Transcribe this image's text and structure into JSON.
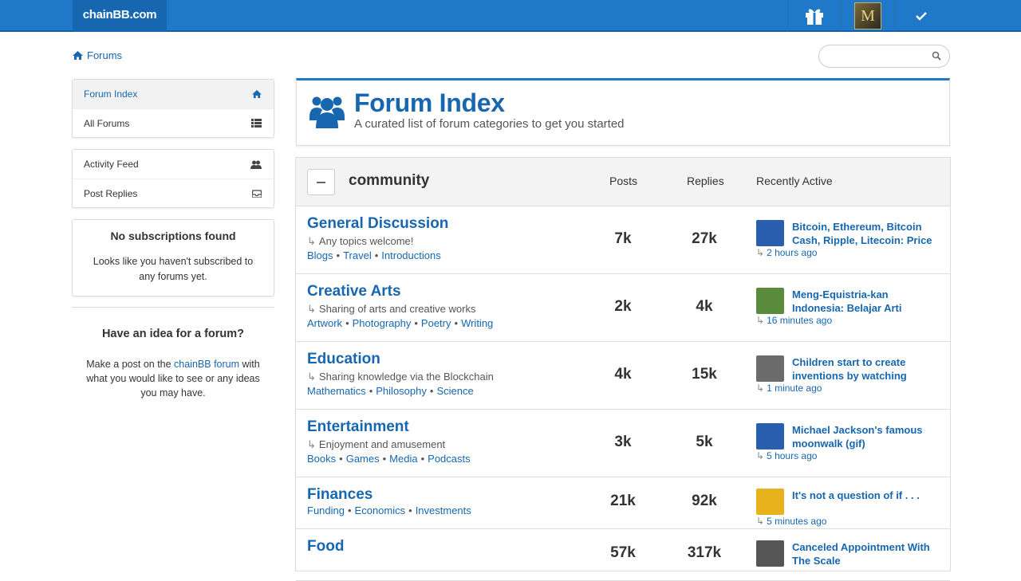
{
  "topbar": {
    "brand": "chainBB.com",
    "avatar_letter": "M"
  },
  "breadcrumb": {
    "label": "Forums"
  },
  "search": {
    "placeholder": "",
    "value": ""
  },
  "sidebar": {
    "nav": [
      {
        "label": "Forum Index",
        "icon": "home-icon"
      },
      {
        "label": "All Forums",
        "icon": "list-icon"
      }
    ],
    "activity": [
      {
        "label": "Activity Feed",
        "icon": "users-icon"
      },
      {
        "label": "Post Replies",
        "icon": "inbox-icon"
      }
    ],
    "no_subs": {
      "title": "No subscriptions found",
      "text": "Looks like you haven't subscribed to any forums yet."
    },
    "idea": {
      "title": "Have an idea for a forum?",
      "text_before": "Make a post on the ",
      "link": "chainBB forum",
      "text_after": " with what you would like to see or any ideas you may have."
    }
  },
  "header": {
    "title": "Forum Index",
    "subtitle": "A curated list of forum categories to get you started"
  },
  "category": {
    "name": "community",
    "columns": {
      "posts": "Posts",
      "replies": "Replies",
      "recent": "Recently Active"
    },
    "forums": [
      {
        "title": "General Discussion",
        "desc": "Any topics welcome!",
        "subs": [
          "Blogs",
          "Travel",
          "Introductions"
        ],
        "posts": "7k",
        "replies": "27k",
        "recent_title": "Bitcoin, Ethereum, Bitcoin Cash, Ripple, Litecoin: Price",
        "recent_time": "2 hours ago",
        "thumb_color": "#2a5fb0"
      },
      {
        "title": "Creative Arts",
        "desc": "Sharing of arts and creative works",
        "subs": [
          "Artwork",
          "Photography",
          "Poetry",
          "Writing"
        ],
        "posts": "2k",
        "replies": "4k",
        "recent_title": "Meng-Equistria-kan Indonesia: Belajar Arti",
        "recent_time": "16 minutes ago",
        "thumb_color": "#5a8a3c"
      },
      {
        "title": "Education",
        "desc": "Sharing knowledge via the Blockchain",
        "subs": [
          "Mathematics",
          "Philosophy",
          "Science"
        ],
        "posts": "4k",
        "replies": "15k",
        "recent_title": "Children start to create inventions by watching",
        "recent_time": "1 minute ago",
        "thumb_color": "#6b6b6b"
      },
      {
        "title": "Entertainment",
        "desc": "Enjoyment and amusement",
        "subs": [
          "Books",
          "Games",
          "Media",
          "Podcasts"
        ],
        "posts": "3k",
        "replies": "5k",
        "recent_title": "Michael Jackson's famous moonwalk (gif)",
        "recent_time": "5 hours ago",
        "thumb_color": "#2a5fb0"
      },
      {
        "title": "Finances",
        "desc": "",
        "subs": [
          "Funding",
          "Economics",
          "Investments"
        ],
        "posts": "21k",
        "replies": "92k",
        "recent_title": "It's not a question of if . . .",
        "recent_time": "5 minutes ago",
        "thumb_color": "#e8b21c"
      },
      {
        "title": "Food",
        "desc": "",
        "subs": [],
        "posts": "57k",
        "replies": "317k",
        "recent_title": "Canceled Appointment With The Scale",
        "recent_time": "",
        "thumb_color": "#555555"
      }
    ]
  }
}
